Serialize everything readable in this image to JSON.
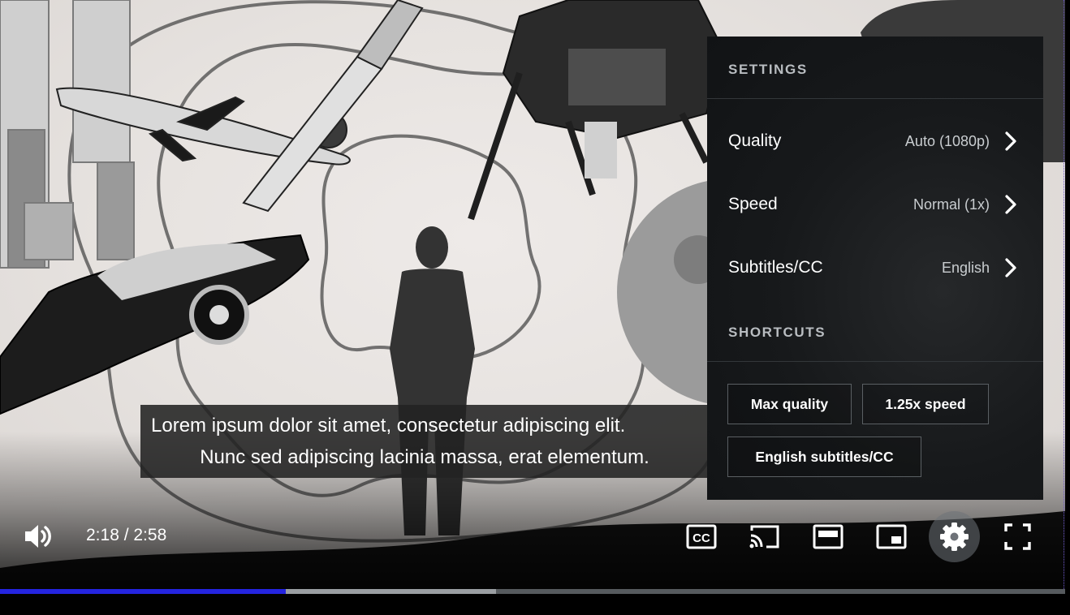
{
  "settings": {
    "title": "SETTINGS",
    "quality": {
      "label": "Quality",
      "value": "Auto (1080p)"
    },
    "speed": {
      "label": "Speed",
      "value": "Normal (1x)"
    },
    "subtitles": {
      "label": "Subtitles/CC",
      "value": "English"
    },
    "shortcuts_title": "SHORTCUTS",
    "shortcuts": [
      "Max quality",
      "1.25x speed",
      "English subtitles/CC"
    ]
  },
  "captions": {
    "line1": "Lorem ipsum dolor sit amet, consectetur adipiscing elit.",
    "line2": "Nunc sed adipiscing lacinia massa, erat elementum."
  },
  "controls": {
    "time": "2:18 / 2:58",
    "icons": [
      "volume-icon",
      "closed-captions-icon",
      "cast-icon",
      "theater-mode-icon",
      "miniplayer-icon",
      "settings-gear-icon",
      "fullscreen-icon"
    ]
  },
  "progress": {
    "played_fraction": 0.268,
    "buffered_fraction": 0.466
  },
  "colors": {
    "progress_played": "#2424e0",
    "menu_background": "#17191b",
    "caption_background": "#222222"
  }
}
